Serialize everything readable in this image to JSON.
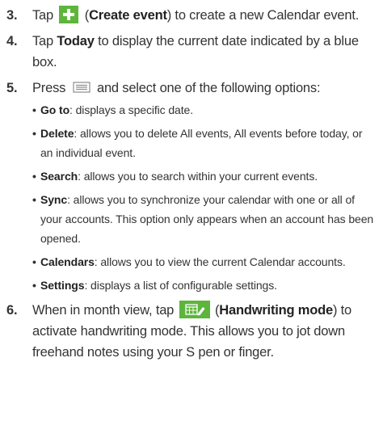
{
  "steps": [
    {
      "number": "3.",
      "before": "Tap",
      "icon": "plus-icon",
      "bold": "Create event",
      "after": ") to create a new Calendar event."
    },
    {
      "number": "4.",
      "before": "Tap ",
      "bold": "Today",
      "after": " to display the current date indicated by a blue box."
    },
    {
      "number": "5.",
      "before": "Press",
      "icon": "menu-icon",
      "after": "and select one of the following options:",
      "options": [
        {
          "term": "Go to",
          "desc": ": displays a specific date."
        },
        {
          "term": "Delete",
          "desc": ": allows you to delete All events, All events before today, or an individual event."
        },
        {
          "term": "Search",
          "desc": ": allows you to search within your current events."
        },
        {
          "term": "Sync",
          "desc": ": allows you to synchronize your calendar with one or all of your accounts. This option only appears when an account has been opened."
        },
        {
          "term": "Calendars",
          "desc": ": allows you to view the current Calendar accounts."
        },
        {
          "term": "Settings",
          "desc": ": displays a list of configurable settings."
        }
      ]
    },
    {
      "number": "6.",
      "before": "When in month view, tap",
      "icon": "handwriting-mode-icon",
      "bold": "Handwriting mode",
      "after": ") to activate handwriting mode. This allows you to jot down freehand notes using your S pen or finger."
    }
  ],
  "colors": {
    "icon_green": "#5db53c",
    "text": "#333333"
  }
}
